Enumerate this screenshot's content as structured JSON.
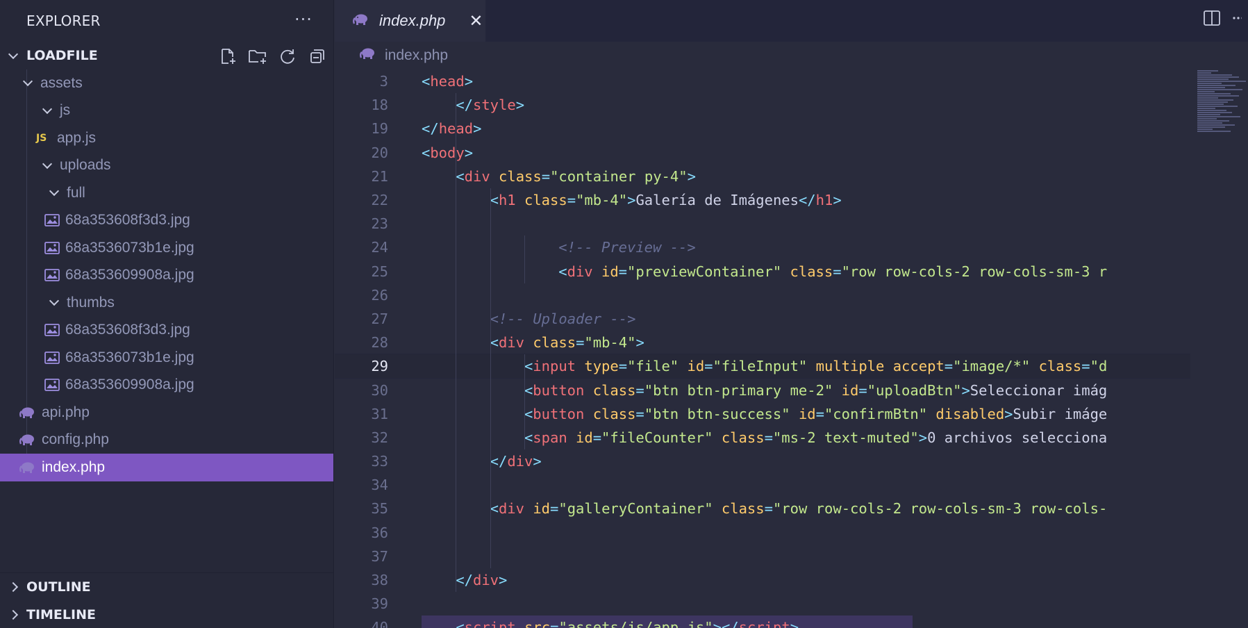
{
  "explorer": {
    "title": "EXPLORER",
    "more": "···",
    "project": "LOADFILE",
    "tree": [
      {
        "label": "assets",
        "kind": "folder",
        "depth": 1
      },
      {
        "label": "js",
        "kind": "folder",
        "depth": 2
      },
      {
        "label": "app.js",
        "kind": "js",
        "depth": 2,
        "badge": "JS"
      },
      {
        "label": "uploads",
        "kind": "folder",
        "depth": 2
      },
      {
        "label": "full",
        "kind": "folder",
        "depth": 3
      },
      {
        "label": "68a353608f3d3.jpg",
        "kind": "image",
        "depth": 3
      },
      {
        "label": "68a3536073b1e.jpg",
        "kind": "image",
        "depth": 3
      },
      {
        "label": "68a353609908a.jpg",
        "kind": "image",
        "depth": 3
      },
      {
        "label": "thumbs",
        "kind": "folder",
        "depth": 3
      },
      {
        "label": "68a353608f3d3.jpg",
        "kind": "image",
        "depth": 3
      },
      {
        "label": "68a3536073b1e.jpg",
        "kind": "image",
        "depth": 3
      },
      {
        "label": "68a353609908a.jpg",
        "kind": "image",
        "depth": 3
      },
      {
        "label": "api.php",
        "kind": "php",
        "depth": 1
      },
      {
        "label": "config.php",
        "kind": "php",
        "depth": 1
      },
      {
        "label": "index.php",
        "kind": "php",
        "depth": 1,
        "selected": true
      }
    ],
    "outline": "OUTLINE",
    "timeline": "TIMELINE"
  },
  "editor": {
    "tab_label": "index.php",
    "close": "✕",
    "breadcrumb": "index.php",
    "current_line": "29",
    "lines": [
      {
        "n": "3",
        "ind": 0,
        "toks": [
          [
            "br",
            "<"
          ],
          [
            "tag",
            "head"
          ],
          [
            "br",
            ">"
          ]
        ]
      },
      {
        "n": "18",
        "ind": 1,
        "toks": [
          [
            "br",
            "</"
          ],
          [
            "tag",
            "style"
          ],
          [
            "br",
            ">"
          ]
        ]
      },
      {
        "n": "19",
        "ind": 0,
        "toks": [
          [
            "br",
            "</"
          ],
          [
            "tag",
            "head"
          ],
          [
            "br",
            ">"
          ]
        ]
      },
      {
        "n": "20",
        "ind": 0,
        "toks": [
          [
            "br",
            "<"
          ],
          [
            "tag",
            "body"
          ],
          [
            "br",
            ">"
          ]
        ]
      },
      {
        "n": "21",
        "ind": 1,
        "toks": [
          [
            "br",
            "<"
          ],
          [
            "tag",
            "div"
          ],
          [
            "txt",
            " "
          ],
          [
            "attr",
            "class"
          ],
          [
            "eq",
            "="
          ],
          [
            "str",
            "\"container py-4\""
          ],
          [
            "br",
            ">"
          ]
        ]
      },
      {
        "n": "22",
        "ind": 2,
        "toks": [
          [
            "br",
            "<"
          ],
          [
            "tag",
            "h1"
          ],
          [
            "txt",
            " "
          ],
          [
            "attr",
            "class"
          ],
          [
            "eq",
            "="
          ],
          [
            "str",
            "\"mb-4\""
          ],
          [
            "br",
            ">"
          ],
          [
            "txt",
            "Galería de Imágenes"
          ],
          [
            "br",
            "</"
          ],
          [
            "tag",
            "h1"
          ],
          [
            "br",
            ">"
          ]
        ]
      },
      {
        "n": "23",
        "ind": 0,
        "toks": []
      },
      {
        "n": "24",
        "ind": 4,
        "toks": [
          [
            "com",
            "<!-- Preview -->"
          ]
        ]
      },
      {
        "n": "25",
        "ind": 4,
        "toks": [
          [
            "br",
            "<"
          ],
          [
            "tag",
            "div"
          ],
          [
            "txt",
            " "
          ],
          [
            "attr",
            "id"
          ],
          [
            "eq",
            "="
          ],
          [
            "str",
            "\"previewContainer\""
          ],
          [
            "txt",
            " "
          ],
          [
            "attr",
            "class"
          ],
          [
            "eq",
            "="
          ],
          [
            "str",
            "\"row row-cols-2 row-cols-sm-3 r"
          ]
        ]
      },
      {
        "n": "26",
        "ind": 0,
        "toks": []
      },
      {
        "n": "27",
        "ind": 2,
        "toks": [
          [
            "com",
            "<!-- Uploader -->"
          ]
        ]
      },
      {
        "n": "28",
        "ind": 2,
        "toks": [
          [
            "br",
            "<"
          ],
          [
            "tag",
            "div"
          ],
          [
            "txt",
            " "
          ],
          [
            "attr",
            "class"
          ],
          [
            "eq",
            "="
          ],
          [
            "str",
            "\"mb-4\""
          ],
          [
            "br",
            ">"
          ]
        ]
      },
      {
        "n": "29",
        "ind": 3,
        "toks": [
          [
            "br",
            "<"
          ],
          [
            "tag",
            "input"
          ],
          [
            "txt",
            " "
          ],
          [
            "attr",
            "type"
          ],
          [
            "eq",
            "="
          ],
          [
            "str",
            "\"file\""
          ],
          [
            "txt",
            " "
          ],
          [
            "attr",
            "id"
          ],
          [
            "eq",
            "="
          ],
          [
            "str",
            "\"fileInput\""
          ],
          [
            "txt",
            " "
          ],
          [
            "attr",
            "multiple"
          ],
          [
            "txt",
            " "
          ],
          [
            "attr",
            "accept"
          ],
          [
            "eq",
            "="
          ],
          [
            "str",
            "\"image/*\""
          ],
          [
            "txt",
            " "
          ],
          [
            "attr",
            "class"
          ],
          [
            "eq",
            "="
          ],
          [
            "str",
            "\"d"
          ]
        ]
      },
      {
        "n": "30",
        "ind": 3,
        "toks": [
          [
            "br",
            "<"
          ],
          [
            "tag",
            "button"
          ],
          [
            "txt",
            " "
          ],
          [
            "attr",
            "class"
          ],
          [
            "eq",
            "="
          ],
          [
            "str",
            "\"btn btn-primary me-2\""
          ],
          [
            "txt",
            " "
          ],
          [
            "attr",
            "id"
          ],
          [
            "eq",
            "="
          ],
          [
            "str",
            "\"uploadBtn\""
          ],
          [
            "br",
            ">"
          ],
          [
            "txt",
            "Seleccionar imág"
          ]
        ]
      },
      {
        "n": "31",
        "ind": 3,
        "toks": [
          [
            "br",
            "<"
          ],
          [
            "tag",
            "button"
          ],
          [
            "txt",
            " "
          ],
          [
            "attr",
            "class"
          ],
          [
            "eq",
            "="
          ],
          [
            "str",
            "\"btn btn-success\""
          ],
          [
            "txt",
            " "
          ],
          [
            "attr",
            "id"
          ],
          [
            "eq",
            "="
          ],
          [
            "str",
            "\"confirmBtn\""
          ],
          [
            "txt",
            " "
          ],
          [
            "attr",
            "disabled"
          ],
          [
            "br",
            ">"
          ],
          [
            "txt",
            "Subir imáge"
          ]
        ]
      },
      {
        "n": "32",
        "ind": 3,
        "toks": [
          [
            "br",
            "<"
          ],
          [
            "tag",
            "span"
          ],
          [
            "txt",
            " "
          ],
          [
            "attr",
            "id"
          ],
          [
            "eq",
            "="
          ],
          [
            "str",
            "\"fileCounter\""
          ],
          [
            "txt",
            " "
          ],
          [
            "attr",
            "class"
          ],
          [
            "eq",
            "="
          ],
          [
            "str",
            "\"ms-2 text-muted\""
          ],
          [
            "br",
            ">"
          ],
          [
            "txt",
            "0 archivos selecciona"
          ]
        ]
      },
      {
        "n": "33",
        "ind": 2,
        "toks": [
          [
            "br",
            "</"
          ],
          [
            "tag",
            "div"
          ],
          [
            "br",
            ">"
          ]
        ]
      },
      {
        "n": "34",
        "ind": 0,
        "toks": []
      },
      {
        "n": "35",
        "ind": 2,
        "toks": [
          [
            "br",
            "<"
          ],
          [
            "tag",
            "div"
          ],
          [
            "txt",
            " "
          ],
          [
            "attr",
            "id"
          ],
          [
            "eq",
            "="
          ],
          [
            "str",
            "\"galleryContainer\""
          ],
          [
            "txt",
            " "
          ],
          [
            "attr",
            "class"
          ],
          [
            "eq",
            "="
          ],
          [
            "str",
            "\"row row-cols-2 row-cols-sm-3 row-cols-"
          ]
        ]
      },
      {
        "n": "36",
        "ind": 0,
        "toks": []
      },
      {
        "n": "37",
        "ind": 0,
        "toks": []
      },
      {
        "n": "38",
        "ind": 1,
        "toks": [
          [
            "br",
            "</"
          ],
          [
            "tag",
            "div"
          ],
          [
            "br",
            ">"
          ]
        ]
      },
      {
        "n": "39",
        "ind": 0,
        "toks": []
      },
      {
        "n": "40",
        "ind": 1,
        "toks": [
          [
            "br",
            "<"
          ],
          [
            "tag",
            "script"
          ],
          [
            "txt",
            " "
          ],
          [
            "attr",
            "src"
          ],
          [
            "eq",
            "="
          ],
          [
            "str",
            "\"assets/js/app.js\""
          ],
          [
            "br",
            ">"
          ],
          [
            "br",
            "</"
          ],
          [
            "tag",
            "script"
          ],
          [
            "br",
            ">"
          ]
        ]
      }
    ]
  },
  "colors": {
    "accent": "#7e57c2",
    "tag": "#f07178",
    "attr": "#ffcb6b",
    "string": "#c3e88d",
    "punct": "#89ddff",
    "comment": "#676e95",
    "php_icon": "#8e79c7",
    "image_icon": "#9d8ee0"
  },
  "icons": [
    "new-file-icon",
    "new-folder-icon",
    "refresh-icon",
    "collapse-all-icon",
    "split-editor-icon",
    "more-actions-icon",
    "php-elephant-icon",
    "image-file-icon",
    "chevron-down-icon",
    "chevron-right-icon",
    "close-icon"
  ]
}
